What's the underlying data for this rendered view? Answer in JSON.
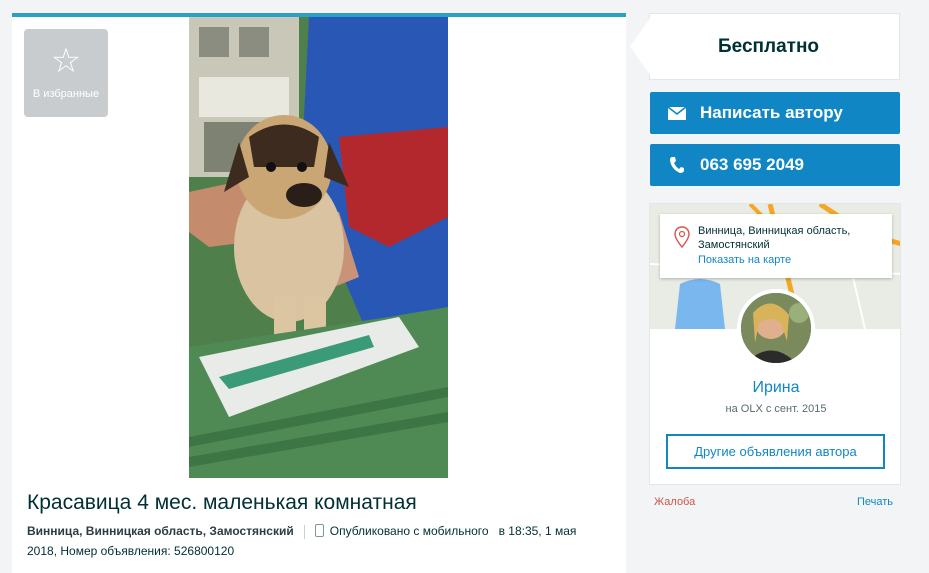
{
  "favorites": {
    "label": "В избранные",
    "icon": "star-icon"
  },
  "ad": {
    "title": "Красавица 4 мес. маленькая комнатная",
    "location": "Винница, Винницкая область, Замостянский",
    "published_from": "Опубликовано с мобильного",
    "published_at": "в 18:35, 1 мая",
    "published_year_id": "2018, Номер объявления: 526800120"
  },
  "price": {
    "text": "Бесплатно"
  },
  "actions": {
    "write_author": "Написать автору",
    "phone": "063 695 2049"
  },
  "map": {
    "address_line": "Винница, Винницкая область, Замостянский",
    "show_on_map": "Показать на карте"
  },
  "seller": {
    "name": "Ирина",
    "since": "на OLX с сент. 2015",
    "other_ads": "Другие объявления автора"
  },
  "footer": {
    "complain": "Жалоба",
    "print": "Печать"
  },
  "colors": {
    "accent": "#1087c4",
    "top_bar": "#2aa0c4",
    "complain": "#c9574d"
  }
}
